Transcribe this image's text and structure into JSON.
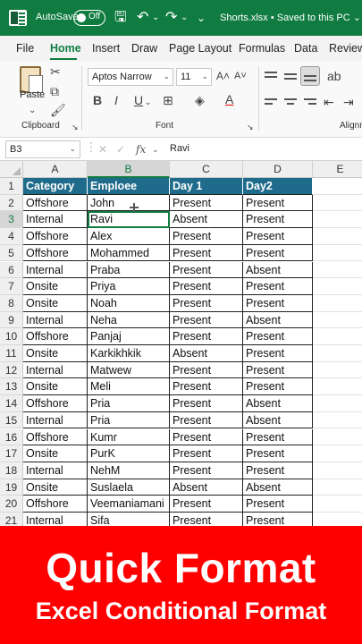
{
  "titlebar": {
    "autosave_label": "AutoSave",
    "toggle_state": "Off",
    "filename": "Shorts.xlsx • Saved to this PC ⌄",
    "save_icon": "save-icon",
    "undo_icon": "undo-icon",
    "redo_icon": "redo-icon",
    "colors": {
      "bar": "#107c41"
    }
  },
  "menu": {
    "tabs": [
      "File",
      "Home",
      "Insert",
      "Draw",
      "Page Layout",
      "Formulas",
      "Data",
      "Review"
    ],
    "active": "Home"
  },
  "ribbon": {
    "clipboard": {
      "paste_label": "Paste",
      "group_label": "Clipboard"
    },
    "font": {
      "font_name": "Aptos Narrow",
      "font_size": "11",
      "group_label": "Font",
      "bold": "B",
      "italic": "I",
      "underline": "U"
    },
    "alignment": {
      "group_label": "Alignm"
    }
  },
  "formula_bar": {
    "name_box": "B3",
    "fx_label": "fx",
    "value": "Ravi"
  },
  "sheet": {
    "columns": [
      "A",
      "B",
      "C",
      "D",
      "E"
    ],
    "selected_column": "B",
    "selected_row": "3",
    "active_cell": "B3",
    "header_color": "#1f6b8c",
    "rows": [
      {
        "n": "1",
        "cells": [
          "Category",
          "Emploee",
          "Day 1",
          "Day2"
        ]
      },
      {
        "n": "2",
        "cells": [
          "Offshore",
          "John",
          "Present",
          "Present"
        ]
      },
      {
        "n": "3",
        "cells": [
          "Internal",
          "Ravi",
          "Absent",
          "Present"
        ]
      },
      {
        "n": "4",
        "cells": [
          "Offshore",
          "Alex",
          "Present",
          "Present"
        ]
      },
      {
        "n": "5",
        "cells": [
          "Offshore",
          "Mohammed",
          "Present",
          "Present"
        ]
      },
      {
        "n": "6",
        "cells": [
          "Internal",
          "Praba",
          "Present",
          "Absent"
        ]
      },
      {
        "n": "7",
        "cells": [
          "Onsite",
          "Priya",
          "Present",
          "Present"
        ]
      },
      {
        "n": "8",
        "cells": [
          "Onsite",
          "Noah",
          "Present",
          "Present"
        ]
      },
      {
        "n": "9",
        "cells": [
          "Internal",
          "Neha",
          "Present",
          "Absent"
        ]
      },
      {
        "n": "10",
        "cells": [
          "Offshore",
          "Panjaj",
          "Present",
          "Present"
        ]
      },
      {
        "n": "11",
        "cells": [
          "Onsite",
          "Karkikhkik",
          "Absent",
          "Present"
        ]
      },
      {
        "n": "12",
        "cells": [
          "Internal",
          "Matwew",
          "Present",
          "Present"
        ]
      },
      {
        "n": "13",
        "cells": [
          "Onsite",
          "Meli",
          "Present",
          "Present"
        ]
      },
      {
        "n": "14",
        "cells": [
          "Offshore",
          "Pria",
          "Present",
          "Absent"
        ]
      },
      {
        "n": "15",
        "cells": [
          "Internal",
          "Pria",
          "Present",
          "Absent"
        ]
      },
      {
        "n": "16",
        "cells": [
          "Offshore",
          "Kumr",
          "Present",
          "Present"
        ]
      },
      {
        "n": "17",
        "cells": [
          "Onsite",
          "PurK",
          "Present",
          "Present"
        ]
      },
      {
        "n": "18",
        "cells": [
          "Internal",
          "NehM",
          "Present",
          "Present"
        ]
      },
      {
        "n": "19",
        "cells": [
          "Onsite",
          "Suslaela",
          "Absent",
          "Absent"
        ]
      },
      {
        "n": "20",
        "cells": [
          "Offshore",
          "Veemaniamani",
          "Present",
          "Present"
        ]
      },
      {
        "n": "21",
        "cells": [
          "Internal",
          "Sifa",
          "Present",
          "Present"
        ]
      }
    ]
  },
  "banner": {
    "title": "Quick Format",
    "subtitle": "Excel Conditional Format",
    "color": "#ff0000"
  }
}
